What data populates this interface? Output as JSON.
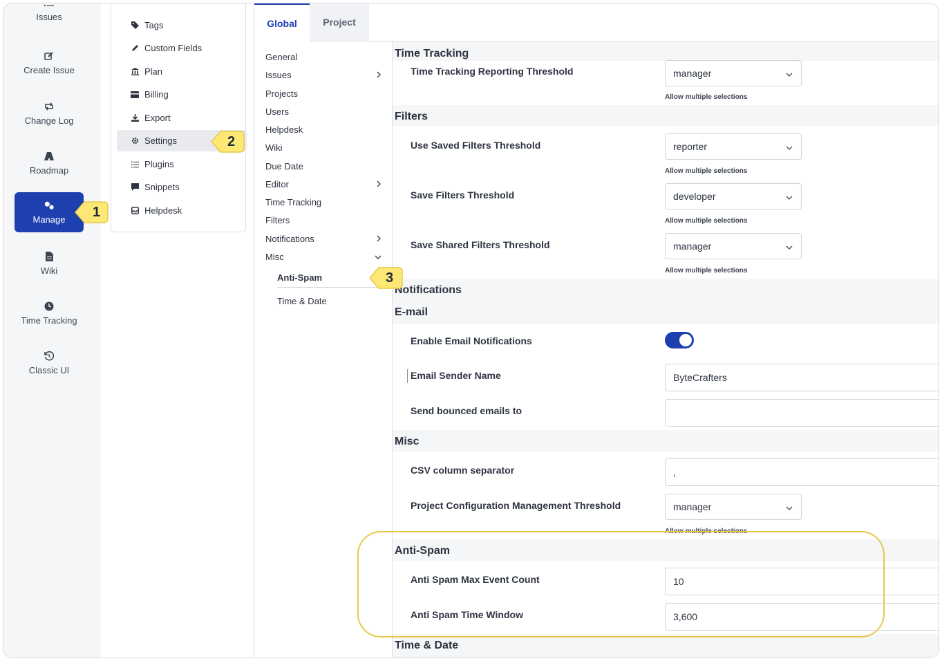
{
  "leftnav": {
    "items": [
      {
        "label": "Issues",
        "icon": "list-icon"
      },
      {
        "label": "Create Issue",
        "icon": "edit-icon"
      },
      {
        "label": "Change Log",
        "icon": "repeat-icon"
      },
      {
        "label": "Roadmap",
        "icon": "road-icon"
      },
      {
        "label": "Manage",
        "icon": "gears-icon",
        "active": true
      },
      {
        "label": "Wiki",
        "icon": "document-icon"
      },
      {
        "label": "Time Tracking",
        "icon": "clock-icon"
      },
      {
        "label": "Classic UI",
        "icon": "history-icon"
      }
    ]
  },
  "submenu": {
    "items": [
      {
        "label": "Tags",
        "icon": "tag-icon"
      },
      {
        "label": "Custom Fields",
        "icon": "pencil-icon"
      },
      {
        "label": "Plan",
        "icon": "bank-icon"
      },
      {
        "label": "Billing",
        "icon": "credit-card-icon"
      },
      {
        "label": "Export",
        "icon": "download-icon"
      },
      {
        "label": "Settings",
        "icon": "gear-icon",
        "active": true
      },
      {
        "label": "Plugins",
        "icon": "list-icon"
      },
      {
        "label": "Snippets",
        "icon": "comment-icon"
      },
      {
        "label": "Helpdesk",
        "icon": "inbox-icon"
      }
    ]
  },
  "tabs": [
    {
      "label": "Global",
      "active": true
    },
    {
      "label": "Project",
      "active": false
    }
  ],
  "settings_nav": [
    {
      "label": "General"
    },
    {
      "label": "Issues",
      "chevron": "right"
    },
    {
      "label": "Projects"
    },
    {
      "label": "Users"
    },
    {
      "label": "Helpdesk"
    },
    {
      "label": "Wiki"
    },
    {
      "label": "Due Date"
    },
    {
      "label": "Editor",
      "chevron": "right"
    },
    {
      "label": "Time Tracking"
    },
    {
      "label": "Filters"
    },
    {
      "label": "Notifications",
      "chevron": "right"
    },
    {
      "label": "Misc",
      "chevron": "down"
    },
    {
      "label": "Anti-Spam",
      "child": true,
      "bold": true
    },
    {
      "label": "Time & Date",
      "child": true
    }
  ],
  "panel": {
    "time_tracking": {
      "section": "Time Tracking",
      "reporting_label": "Time Tracking Reporting Threshold",
      "reporting_value": "manager"
    },
    "filters": {
      "section": "Filters",
      "use_saved_label": "Use Saved Filters Threshold",
      "use_saved_value": "reporter",
      "save_label": "Save Filters Threshold",
      "save_value": "developer",
      "save_shared_label": "Save Shared Filters Threshold",
      "save_shared_value": "manager"
    },
    "hint": "Allow multiple selections",
    "notifications": {
      "section": "Notifications"
    },
    "email": {
      "section": "E-mail",
      "enable_label": "Enable Email Notifications",
      "sender_label": "Email Sender Name",
      "sender_value": "ByteCrafters",
      "bounced_label": "Send bounced emails to",
      "bounced_value": ""
    },
    "misc": {
      "section": "Misc",
      "csv_label": "CSV column separator",
      "csv_value": ",",
      "pcm_label": "Project Configuration Management Threshold",
      "pcm_value": "manager"
    },
    "antispam": {
      "section": "Anti-Spam",
      "max_label": "Anti Spam Max Event Count",
      "max_value": "10",
      "window_label": "Anti Spam Time Window",
      "window_value": "3,600"
    },
    "time_date": {
      "section": "Time & Date"
    }
  },
  "callouts": [
    "1",
    "2",
    "3"
  ],
  "colors": {
    "accent": "#1e40af",
    "callout": "#fde875",
    "callout_border": "#e8c84a"
  }
}
